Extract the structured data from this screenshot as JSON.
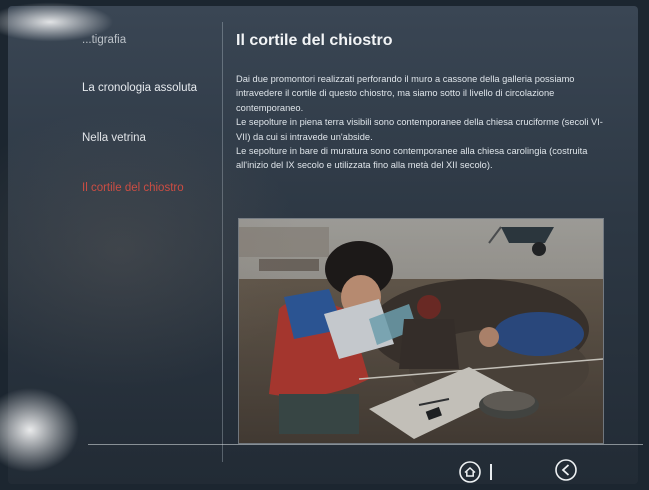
{
  "sidebar": {
    "items": [
      {
        "label": "...tigrafia",
        "active": false
      },
      {
        "label": "La cronologia assoluta",
        "active": false
      },
      {
        "label": "Nella vetrina",
        "active": false
      },
      {
        "label": "Il cortile del chiostro",
        "active": true
      }
    ]
  },
  "main": {
    "title": "Il cortile del chiostro",
    "paragraphs": [
      "Dai due promontori realizzati perforando il muro a cassone della galleria possiamo intravedere il cortile di questo chiostro, ma siamo sotto il livello di circolazione contemporaneo.",
      "Le sepolture in piena terra visibili sono contemporanee della chiesa cruciforme (secoli VI-VII) da cui si intravede un'abside.",
      "Le sepolture in bare di muratura sono contemporanee alla chiesa carolingia (costruita all'inizio del IX secolo e utilizzata fino alla metà del XII secolo)."
    ]
  },
  "footer": {
    "home_icon": "home-icon",
    "back_icon": "back-arrow-icon"
  },
  "colors": {
    "active_nav": "#d8483e",
    "text": "#e6eaee",
    "screen_bg": "#2d3844"
  }
}
